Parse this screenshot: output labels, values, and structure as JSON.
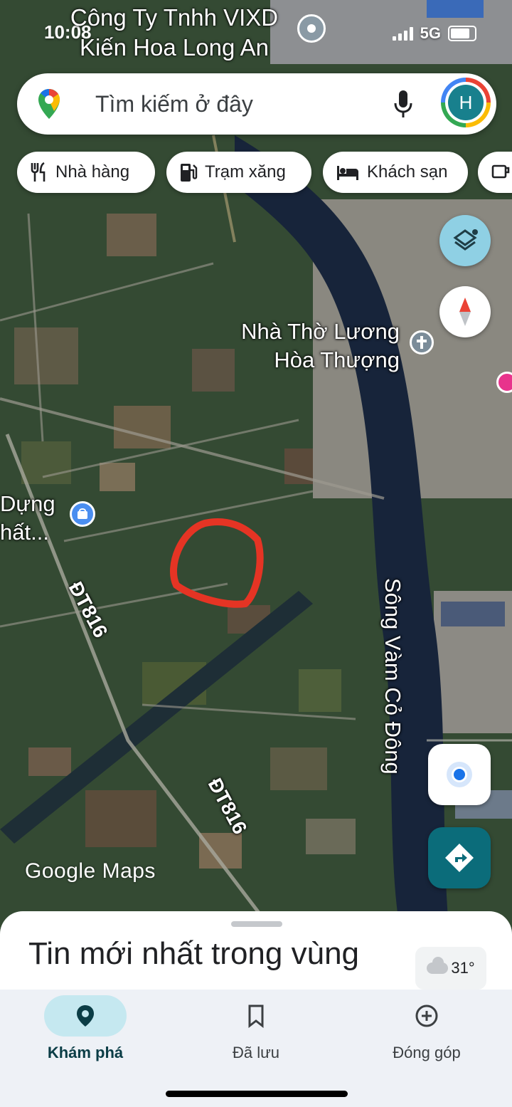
{
  "status_bar": {
    "time": "10:08",
    "network": "5G"
  },
  "map": {
    "top_place_name": [
      "Công Ty Tnhh VIXD",
      "Kiến Hoa Long An"
    ],
    "church_label": [
      "Nhà Thờ Lương",
      "Hòa Thượng"
    ],
    "store_label": [
      "Dựng",
      "hất..."
    ],
    "road_labels": [
      "ĐT816",
      "ĐT816"
    ],
    "river_label": "Sông Vàm Cỏ Đông",
    "watermark": "Google Maps",
    "highlight_color": "#e53424"
  },
  "search": {
    "placeholder": "Tìm kiếm ở đây",
    "avatar_letter": "H"
  },
  "chips": [
    {
      "label": "Nhà hàng",
      "icon": "restaurant-icon"
    },
    {
      "label": "Trạm xăng",
      "icon": "gas-station-icon"
    },
    {
      "label": "Khách sạn",
      "icon": "hotel-icon"
    },
    {
      "label": "",
      "icon": "coffee-icon"
    }
  ],
  "sheet": {
    "title": "Tin mới nhất trong vùng",
    "temperature": "31°"
  },
  "nav": [
    {
      "label": "Khám phá",
      "icon": "location-pin-icon",
      "active": true
    },
    {
      "label": "Đã lưu",
      "icon": "bookmark-icon",
      "active": false
    },
    {
      "label": "Đóng góp",
      "icon": "add-circle-icon",
      "active": false
    }
  ],
  "colors": {
    "accent": "#0b6c7a",
    "nav_active_bg": "#c5e8f0"
  }
}
